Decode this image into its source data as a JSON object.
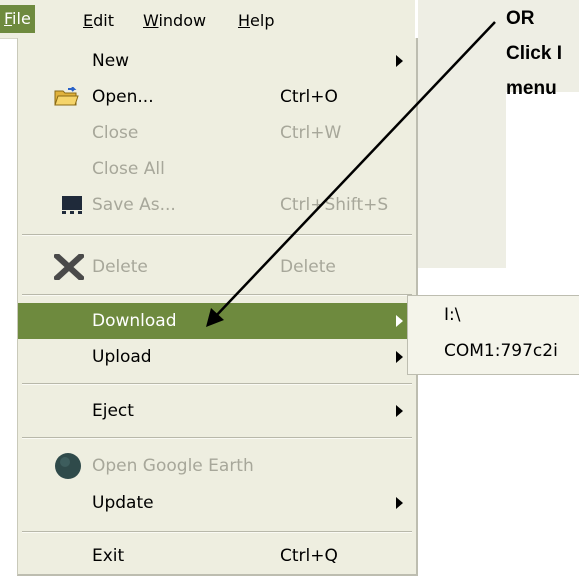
{
  "menubar": {
    "items": [
      {
        "label": "File",
        "mnemonic": "F",
        "rest": "ile"
      },
      {
        "label": "Edit",
        "mnemonic": "E",
        "rest": "dit"
      },
      {
        "label": "Window",
        "mnemonic": "W",
        "rest": "indow"
      },
      {
        "label": "Help",
        "mnemonic": "H",
        "rest": "elp"
      }
    ]
  },
  "file_menu": {
    "items": [
      {
        "label": "New",
        "accel": "",
        "submenu": true,
        "disabled": false
      },
      {
        "label": "Open...",
        "accel": "Ctrl+O",
        "disabled": false,
        "icon": "folder-open-icon"
      },
      {
        "label": "Close",
        "accel": "Ctrl+W",
        "disabled": true
      },
      {
        "label": "Close All",
        "accel": "",
        "disabled": true
      },
      {
        "label": "Save As...",
        "accel": "Ctrl+Shift+S",
        "disabled": true,
        "icon": "save-disk-icon"
      },
      {
        "label": "Delete",
        "accel": "Delete",
        "disabled": true,
        "icon": "delete-x-icon"
      },
      {
        "label": "Download",
        "accel": "",
        "submenu": true,
        "highlighted": true
      },
      {
        "label": "Upload",
        "accel": "",
        "submenu": true
      },
      {
        "label": "Eject",
        "accel": "",
        "submenu": true
      },
      {
        "label": "Open Google Earth",
        "accel": "",
        "disabled": true,
        "icon": "google-earth-globe-icon"
      },
      {
        "label": "Update",
        "accel": "",
        "submenu": true
      },
      {
        "label": "Exit",
        "accel": "Ctrl+Q"
      }
    ]
  },
  "download_submenu": {
    "items": [
      "I:\\",
      "COM1:797c2i"
    ]
  },
  "annotation": {
    "lines": [
      "OR",
      "Click I",
      "menu"
    ]
  },
  "colors": {
    "highlight": "#6e8a3e",
    "menu_bg": "#eeeee0",
    "disabled_text": "#a7a79a"
  }
}
